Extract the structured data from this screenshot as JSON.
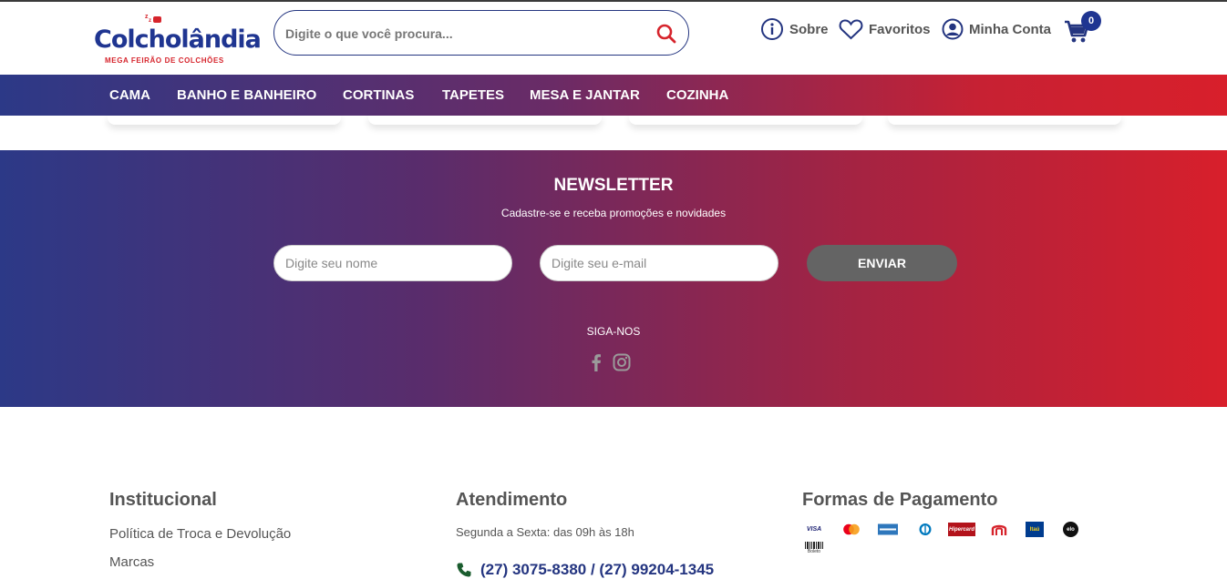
{
  "header": {
    "logo_text_main": "Colcholândia",
    "logo_text_sub": "MEGA FEIRÃO DE COLCHÕES",
    "search_placeholder": "Digite o que você procura...",
    "links": {
      "about": "Sobre",
      "favorites": "Favoritos",
      "account": "Minha Conta"
    },
    "cart_count": "0"
  },
  "nav": {
    "items": [
      "CAMA",
      "BANHO E BANHEIRO",
      "CORTINAS",
      "TAPETES",
      "MESA E JANTAR",
      "COZINHA"
    ]
  },
  "newsletter": {
    "title": "NEWSLETTER",
    "subtitle": "Cadastre-se e receba promoções e novidades",
    "name_placeholder": "Digite seu nome",
    "email_placeholder": "Digite seu e-mail",
    "submit_label": "ENVIAR",
    "follow_label": "SIGA-NOS",
    "social_icons": [
      "facebook-icon",
      "instagram-icon"
    ]
  },
  "footer": {
    "institutional": {
      "title": "Institucional",
      "links": [
        "Política de Troca e Devolução",
        "Marcas"
      ]
    },
    "service": {
      "title": "Atendimento",
      "hours": "Segunda a Sexta: das 09h às 18h",
      "phone": "(27) 3075-8380 / (27) 99204-1345"
    },
    "payment": {
      "title": "Formas de Pagamento",
      "methods": [
        "VISA",
        "mastercard",
        "amex",
        "diners",
        "Hipercard",
        "Banri",
        "Itaú",
        "elo",
        "Boleto"
      ]
    }
  },
  "colors": {
    "brand_blue": "#1f3591",
    "brand_red": "#d81f2b",
    "button_gray": "#646464"
  }
}
